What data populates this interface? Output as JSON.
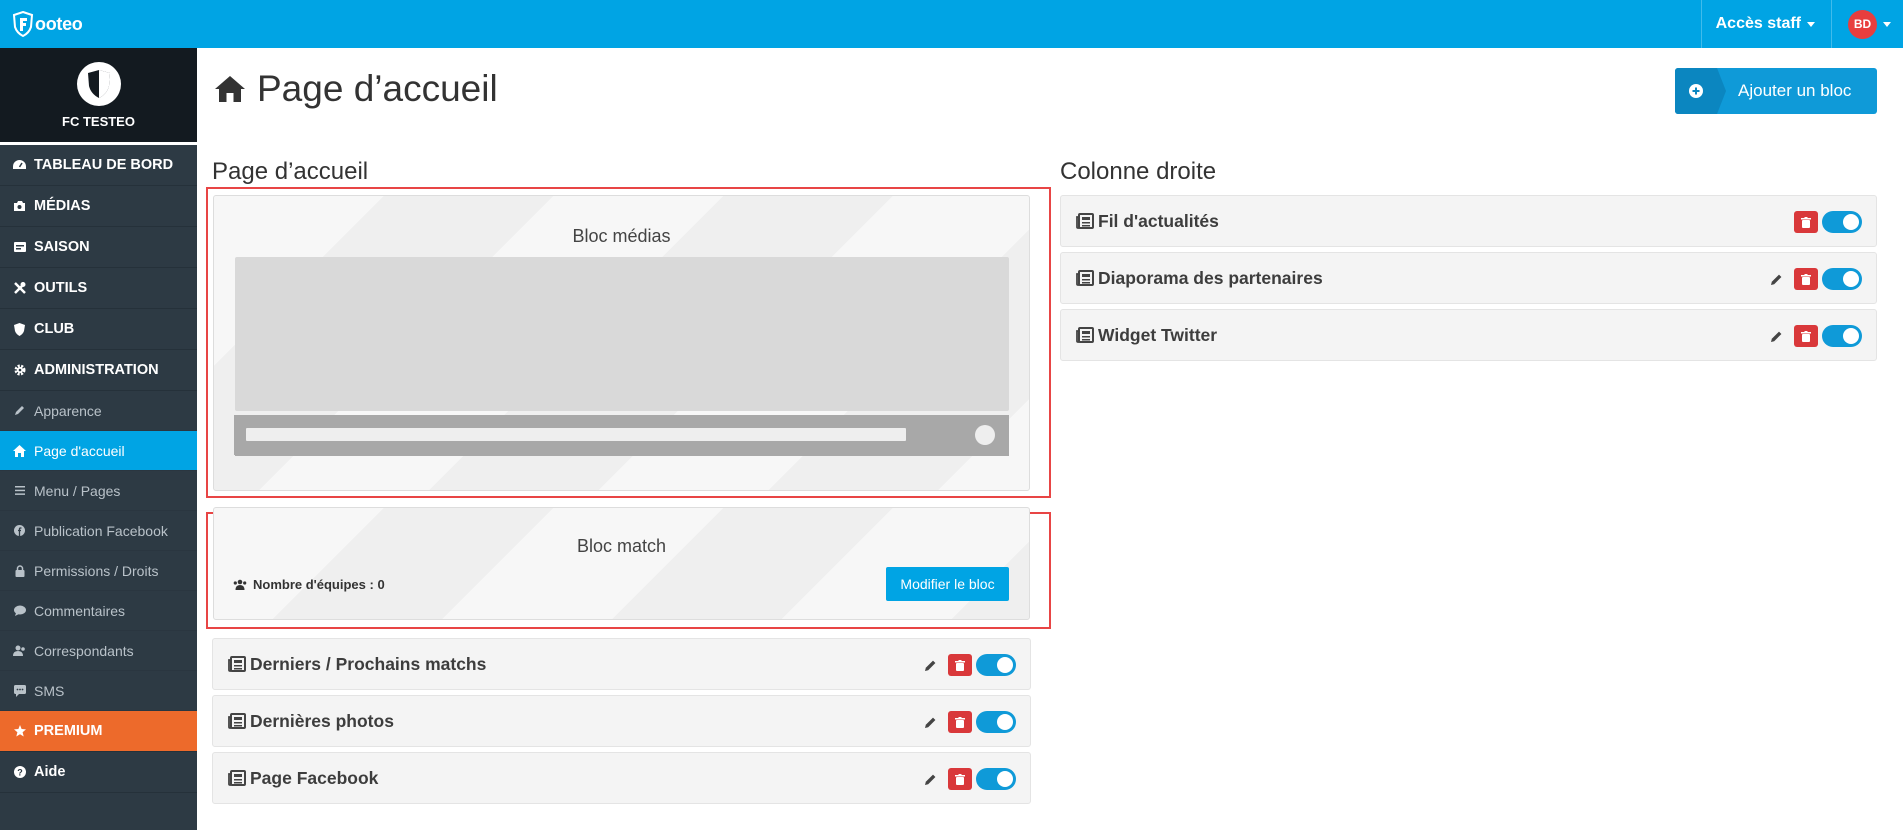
{
  "app": {
    "logo_text": "ooteo"
  },
  "topbar": {
    "acces_label": "Accès staff",
    "avatar_initials": "BD"
  },
  "club": {
    "name": "FC TESTEO"
  },
  "sidebar": {
    "sections": [
      {
        "label": "TABLEAU DE BORD",
        "icon": "dashboard-icon"
      },
      {
        "label": "MÉDIAS",
        "icon": "camera-icon"
      },
      {
        "label": "SAISON",
        "icon": "calendar-icon"
      },
      {
        "label": "OUTILS",
        "icon": "tools-icon"
      },
      {
        "label": "CLUB",
        "icon": "shield-icon"
      },
      {
        "label": "ADMINISTRATION",
        "icon": "gear-icon"
      }
    ],
    "sub_items": [
      {
        "label": "Apparence",
        "icon": "pencil-icon"
      },
      {
        "label": "Page d'accueil",
        "icon": "home-icon",
        "active": true
      },
      {
        "label": "Menu / Pages",
        "icon": "menu-icon"
      },
      {
        "label": "Publication Facebook",
        "icon": "facebook-icon"
      },
      {
        "label": "Permissions / Droits",
        "icon": "lock-icon"
      },
      {
        "label": "Commentaires",
        "icon": "comment-icon"
      },
      {
        "label": "Correspondants",
        "icon": "users-icon"
      },
      {
        "label": "SMS",
        "icon": "sms-icon"
      }
    ],
    "premium_label": "PREMIUM",
    "aide_label": "Aide"
  },
  "main": {
    "title": "Page d’accueil",
    "add_button": "Ajouter un bloc",
    "left_column": {
      "title": "Page d’accueil",
      "bloc_medias": "Bloc médias",
      "bloc_match": "Bloc match",
      "nb_equipes": "Nombre d'équipes : 0",
      "modifier_btn": "Modifier le bloc",
      "rows": [
        "Derniers / Prochains matchs",
        "Dernières photos",
        "Page Facebook"
      ]
    },
    "right_column": {
      "title": "Colonne droite",
      "rows": [
        "Fil d'actualités",
        "Diaporama des partenaires",
        "Widget Twitter"
      ]
    }
  },
  "colors": {
    "accent": "#00a4e4",
    "premium": "#ed6a2b",
    "delete": "#d9383a",
    "sidebar": "#2d3a44"
  }
}
